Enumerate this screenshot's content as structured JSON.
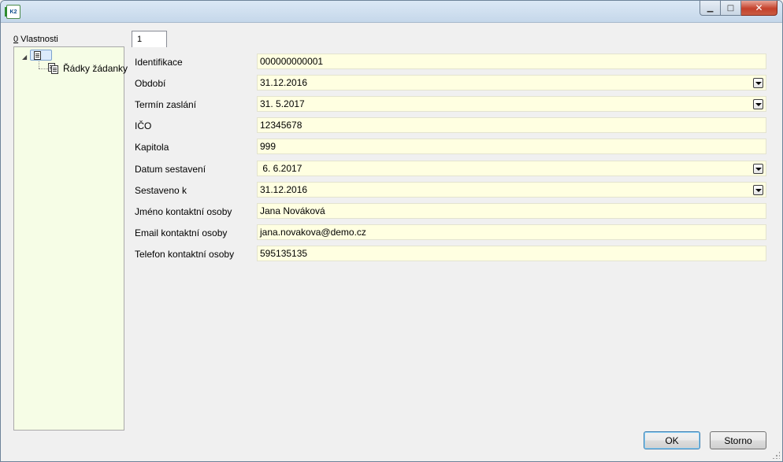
{
  "panel": {
    "label_underline": "0",
    "label_rest": " Vlastnosti"
  },
  "tree": {
    "child_label": "Řádky žádanky"
  },
  "tab": {
    "label": "1"
  },
  "form": {
    "rows": [
      {
        "label": "Identifikace",
        "value": "000000000001",
        "dropdown": false
      },
      {
        "label": "Období",
        "value": "31.12.2016",
        "dropdown": true
      },
      {
        "label": "Termín zaslání",
        "value": "31. 5.2017",
        "dropdown": true
      },
      {
        "label": "IČO",
        "value": "12345678",
        "dropdown": false
      },
      {
        "label": "Kapitola",
        "value": "999",
        "dropdown": false
      },
      {
        "label": "Datum sestavení",
        "value": " 6. 6.2017",
        "dropdown": true
      },
      {
        "label": "Sestaveno k",
        "value": "31.12.2016",
        "dropdown": true
      },
      {
        "label": "Jméno kontaktní osoby",
        "value": "Jana Nováková",
        "dropdown": false
      },
      {
        "label": "Email kontaktní osoby",
        "value": "jana.novakova@demo.cz",
        "dropdown": false
      },
      {
        "label": "Telefon kontaktní osoby",
        "value": "595135135",
        "dropdown": false
      }
    ]
  },
  "buttons": {
    "ok_label": "OK",
    "cancel_label": "Storno"
  },
  "icons": {
    "app": "app-icon",
    "minimize": "minimize-icon",
    "maximize": "maximize-icon",
    "close": "close-icon",
    "document": "document-icon",
    "documents": "multi-document-icon",
    "dropdown": "chevron-down-icon"
  },
  "colors": {
    "field_bg": "#ffffe1",
    "tree_bg": "#f6fde6",
    "titlebar": "#c5d7ea"
  }
}
